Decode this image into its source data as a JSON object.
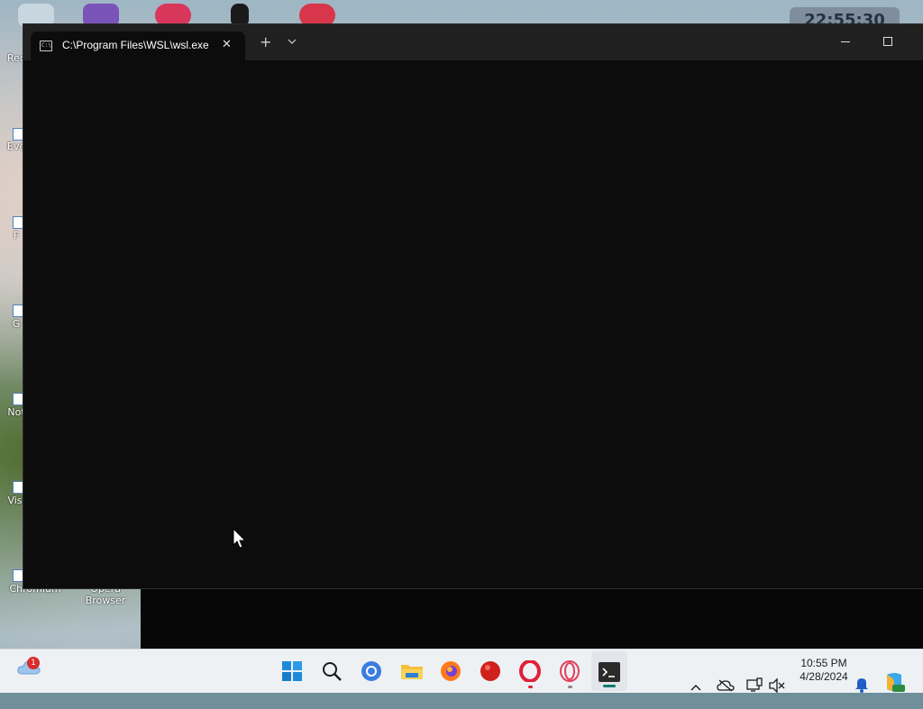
{
  "window": {
    "tab_title": "C:\\Program Files\\WSL\\wsl.exe",
    "new_tab_symbol": "+",
    "close_tab_symbol": "✕"
  },
  "desktop": {
    "clock_widget_text": "22:55:30",
    "icons": [
      {
        "label": "Rec"
      },
      {
        "label": "Eve"
      },
      {
        "label": "F"
      },
      {
        "label": "G"
      },
      {
        "label": "Not"
      },
      {
        "label": "Visu"
      },
      {
        "label": "Chromium"
      },
      {
        "label": "Opera Browser"
      }
    ]
  },
  "taskbar": {
    "weather_badge": "1",
    "apps": [
      {
        "name": "start",
        "icon": "windows-start-icon"
      },
      {
        "name": "search",
        "icon": "search-icon"
      },
      {
        "name": "chromium",
        "icon": "chromium-icon"
      },
      {
        "name": "file-explorer",
        "icon": "folder-icon"
      },
      {
        "name": "firefox",
        "icon": "firefox-icon"
      },
      {
        "name": "red-app",
        "icon": "red-ball-icon"
      },
      {
        "name": "opera",
        "icon": "opera-icon"
      },
      {
        "name": "opera-gx",
        "icon": "opera-gx-icon"
      },
      {
        "name": "terminal",
        "icon": "terminal-icon"
      }
    ],
    "clock": {
      "time": "10:55 PM",
      "date": "4/28/2024"
    }
  },
  "colors": {
    "terminal_bg": "#0c0c0c",
    "titlebar_bg": "#202020",
    "taskbar_bg": "#eef1f4",
    "opera_red": "#e0203a"
  }
}
